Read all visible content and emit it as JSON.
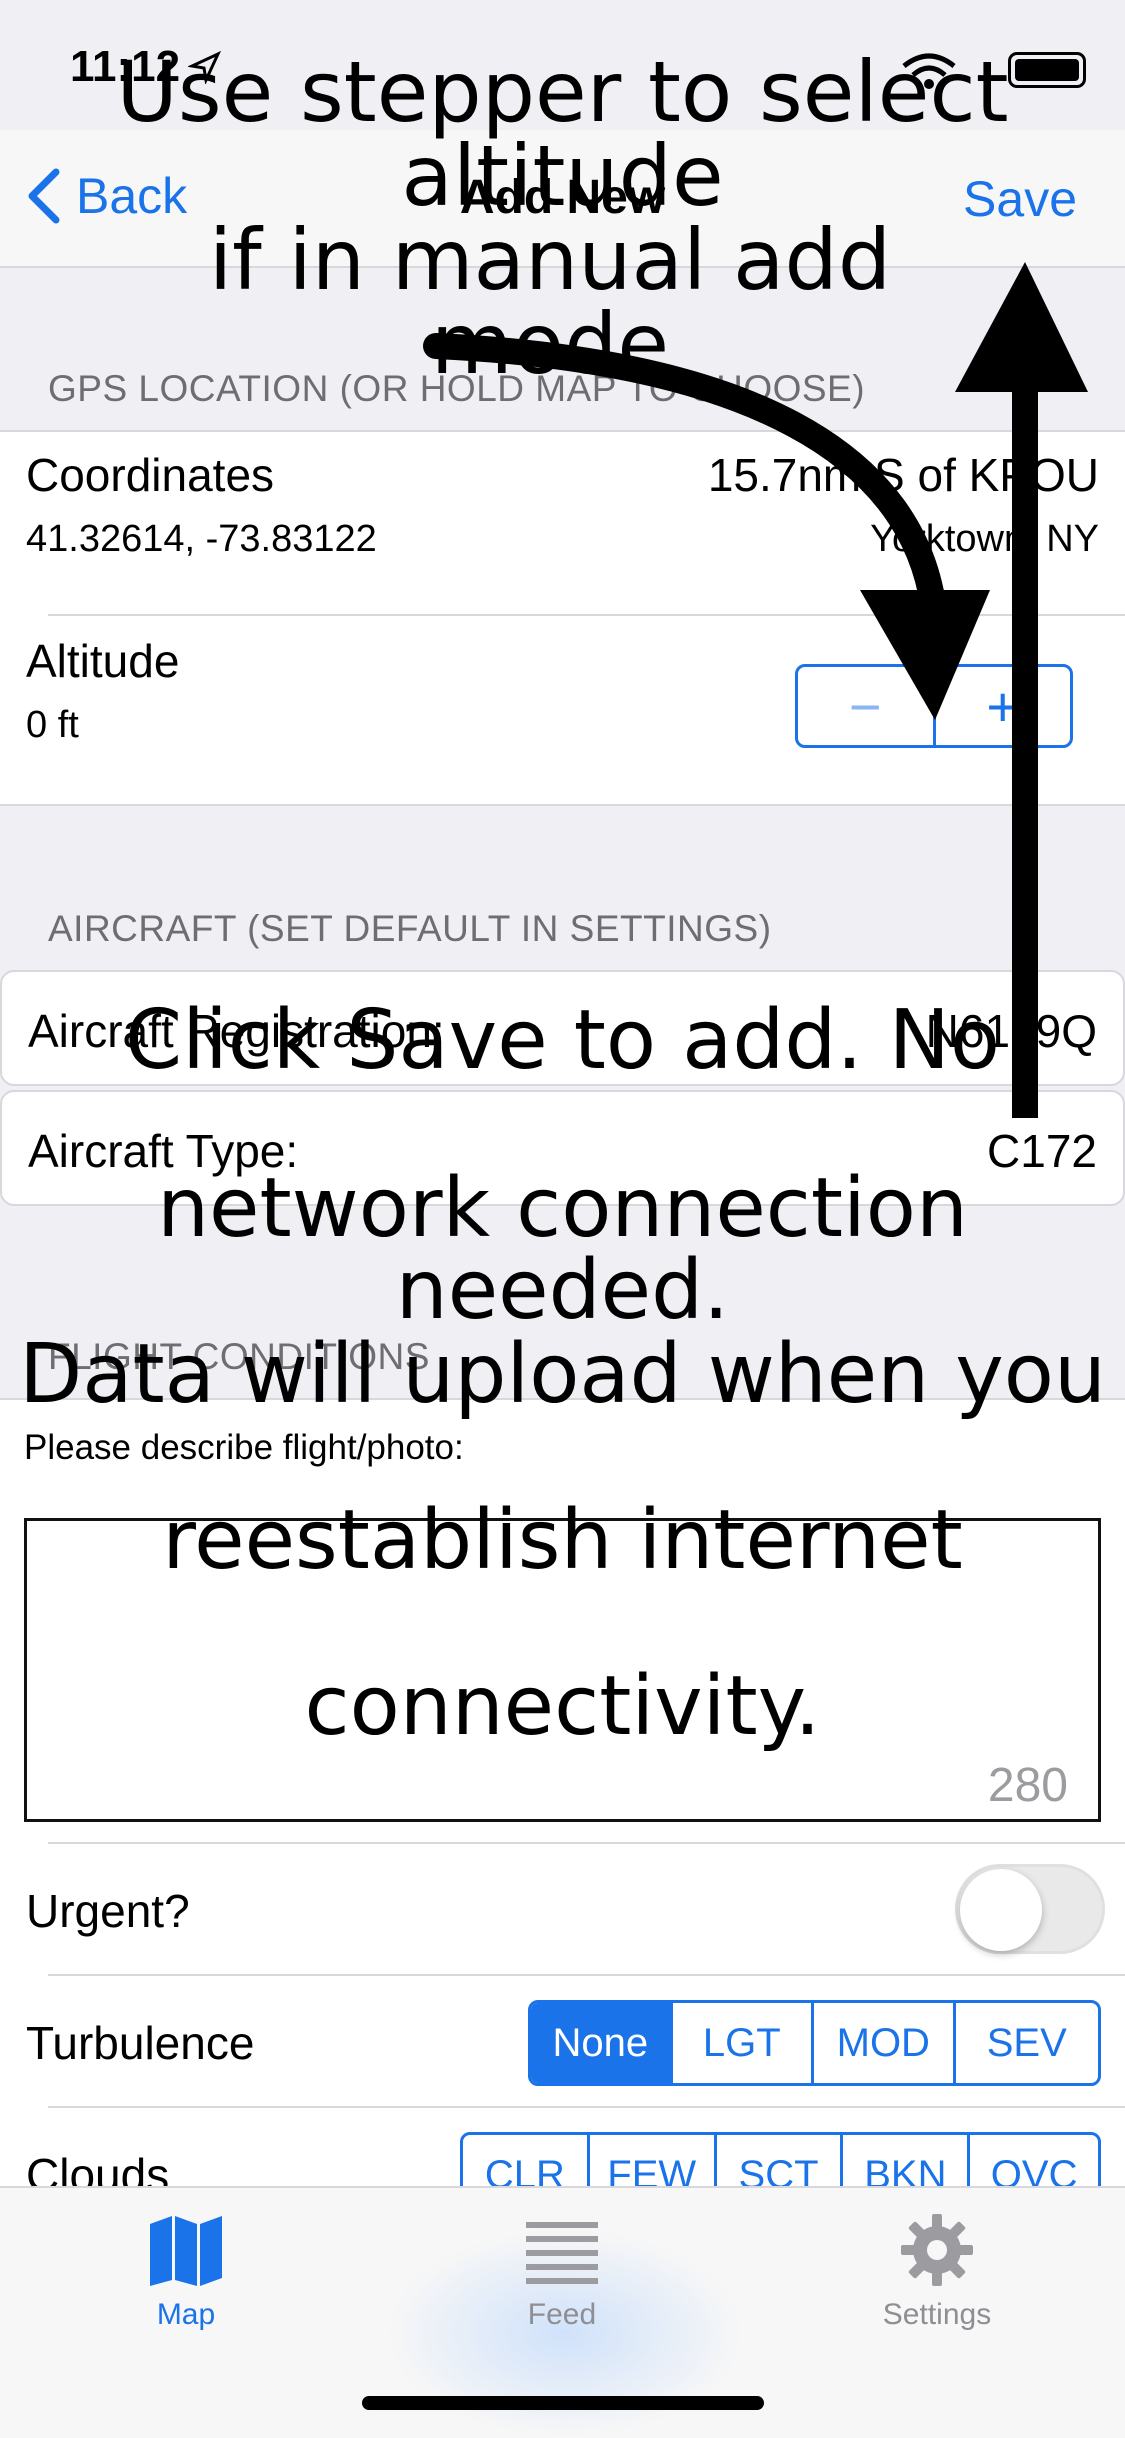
{
  "status_bar": {
    "time": "11:12"
  },
  "nav": {
    "back_label": "Back",
    "title": "Add New",
    "save_label": "Save"
  },
  "gps_section": {
    "header": "GPS LOCATION (OR HOLD MAP TO CHOOSE)",
    "coordinates": {
      "title": "Coordinates",
      "value": "41.32614, -73.83122",
      "distance": "15.7nm S of KPOU",
      "place": "Yorktown, NY"
    },
    "altitude": {
      "title": "Altitude",
      "value": "0 ft",
      "minus": "−",
      "plus": "+"
    }
  },
  "aircraft_section": {
    "header": "AIRCRAFT (SET DEFAULT IN SETTINGS)",
    "registration": {
      "label": "Aircraft Registration:",
      "value": "N6189Q"
    },
    "type": {
      "label": "Aircraft Type:",
      "value": "C172"
    }
  },
  "flight_section": {
    "header": "FLIGHT CONDITIONS",
    "description_label": "Please describe flight/photo:",
    "description_value": "",
    "char_counter": "280",
    "urgent_label": "Urgent?",
    "urgent_on": false,
    "turbulence": {
      "label": "Turbulence",
      "options": [
        "None",
        "LGT",
        "MOD",
        "SEV"
      ],
      "selected": "None"
    },
    "clouds": {
      "label": "Clouds",
      "options": [
        "CLR",
        "FEW",
        "SCT",
        "BKN",
        "OVC"
      ]
    }
  },
  "tab_bar": {
    "tabs": [
      {
        "label": "Map",
        "icon": "map-icon",
        "active": true
      },
      {
        "label": "Feed",
        "icon": "list-icon",
        "active": false
      },
      {
        "label": "Settings",
        "icon": "gear-icon",
        "active": false
      }
    ]
  },
  "annotations": {
    "top_line1": "Use stepper to select altitude",
    "top_line2": "if in manual add mode",
    "middle_line1": "Click Save to add. No",
    "middle_line2": "network connection needed.",
    "middle_line3": "Data will upload when you",
    "middle_line4": "reestablish internet",
    "middle_line5": "connectivity."
  },
  "colors": {
    "accent": "#1a73e8",
    "background": "#efeff4",
    "card": "#ffffff"
  }
}
